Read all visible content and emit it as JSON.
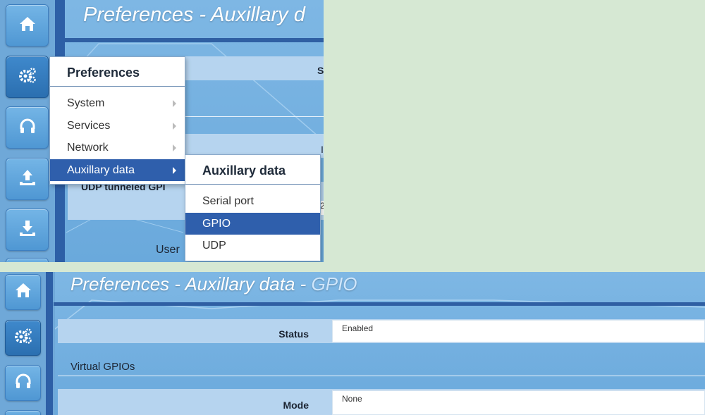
{
  "top": {
    "title": "Preferences - Auxillary d",
    "partial_header": "S",
    "partial_row_label": "UDP tunneled GPI",
    "partial_value": "2",
    "partial_char": "I",
    "user_text": "User",
    "menu": {
      "heading": "Preferences",
      "items": [
        {
          "label": "System"
        },
        {
          "label": "Services"
        },
        {
          "label": "Network"
        },
        {
          "label": "Auxillary data"
        }
      ]
    },
    "submenu": {
      "heading": "Auxillary data",
      "items": [
        {
          "label": "Serial port"
        },
        {
          "label": "GPIO"
        },
        {
          "label": "UDP"
        }
      ]
    }
  },
  "bottom": {
    "title_main": "Preferences - Auxillary data - ",
    "title_accent": "GPIO",
    "status_label": "Status",
    "status_value": "Enabled",
    "section": "Virtual GPIOs",
    "mode_label": "Mode",
    "mode_value": "None"
  },
  "icons": [
    "home-icon",
    "gears-icon",
    "headphones-icon",
    "upload-icon",
    "download-icon"
  ],
  "colors": {
    "background": "#d6e8d3",
    "panel": "#6aa9dc",
    "accent_dark": "#2f5fa3",
    "menu_selected": "#2f5fac"
  }
}
